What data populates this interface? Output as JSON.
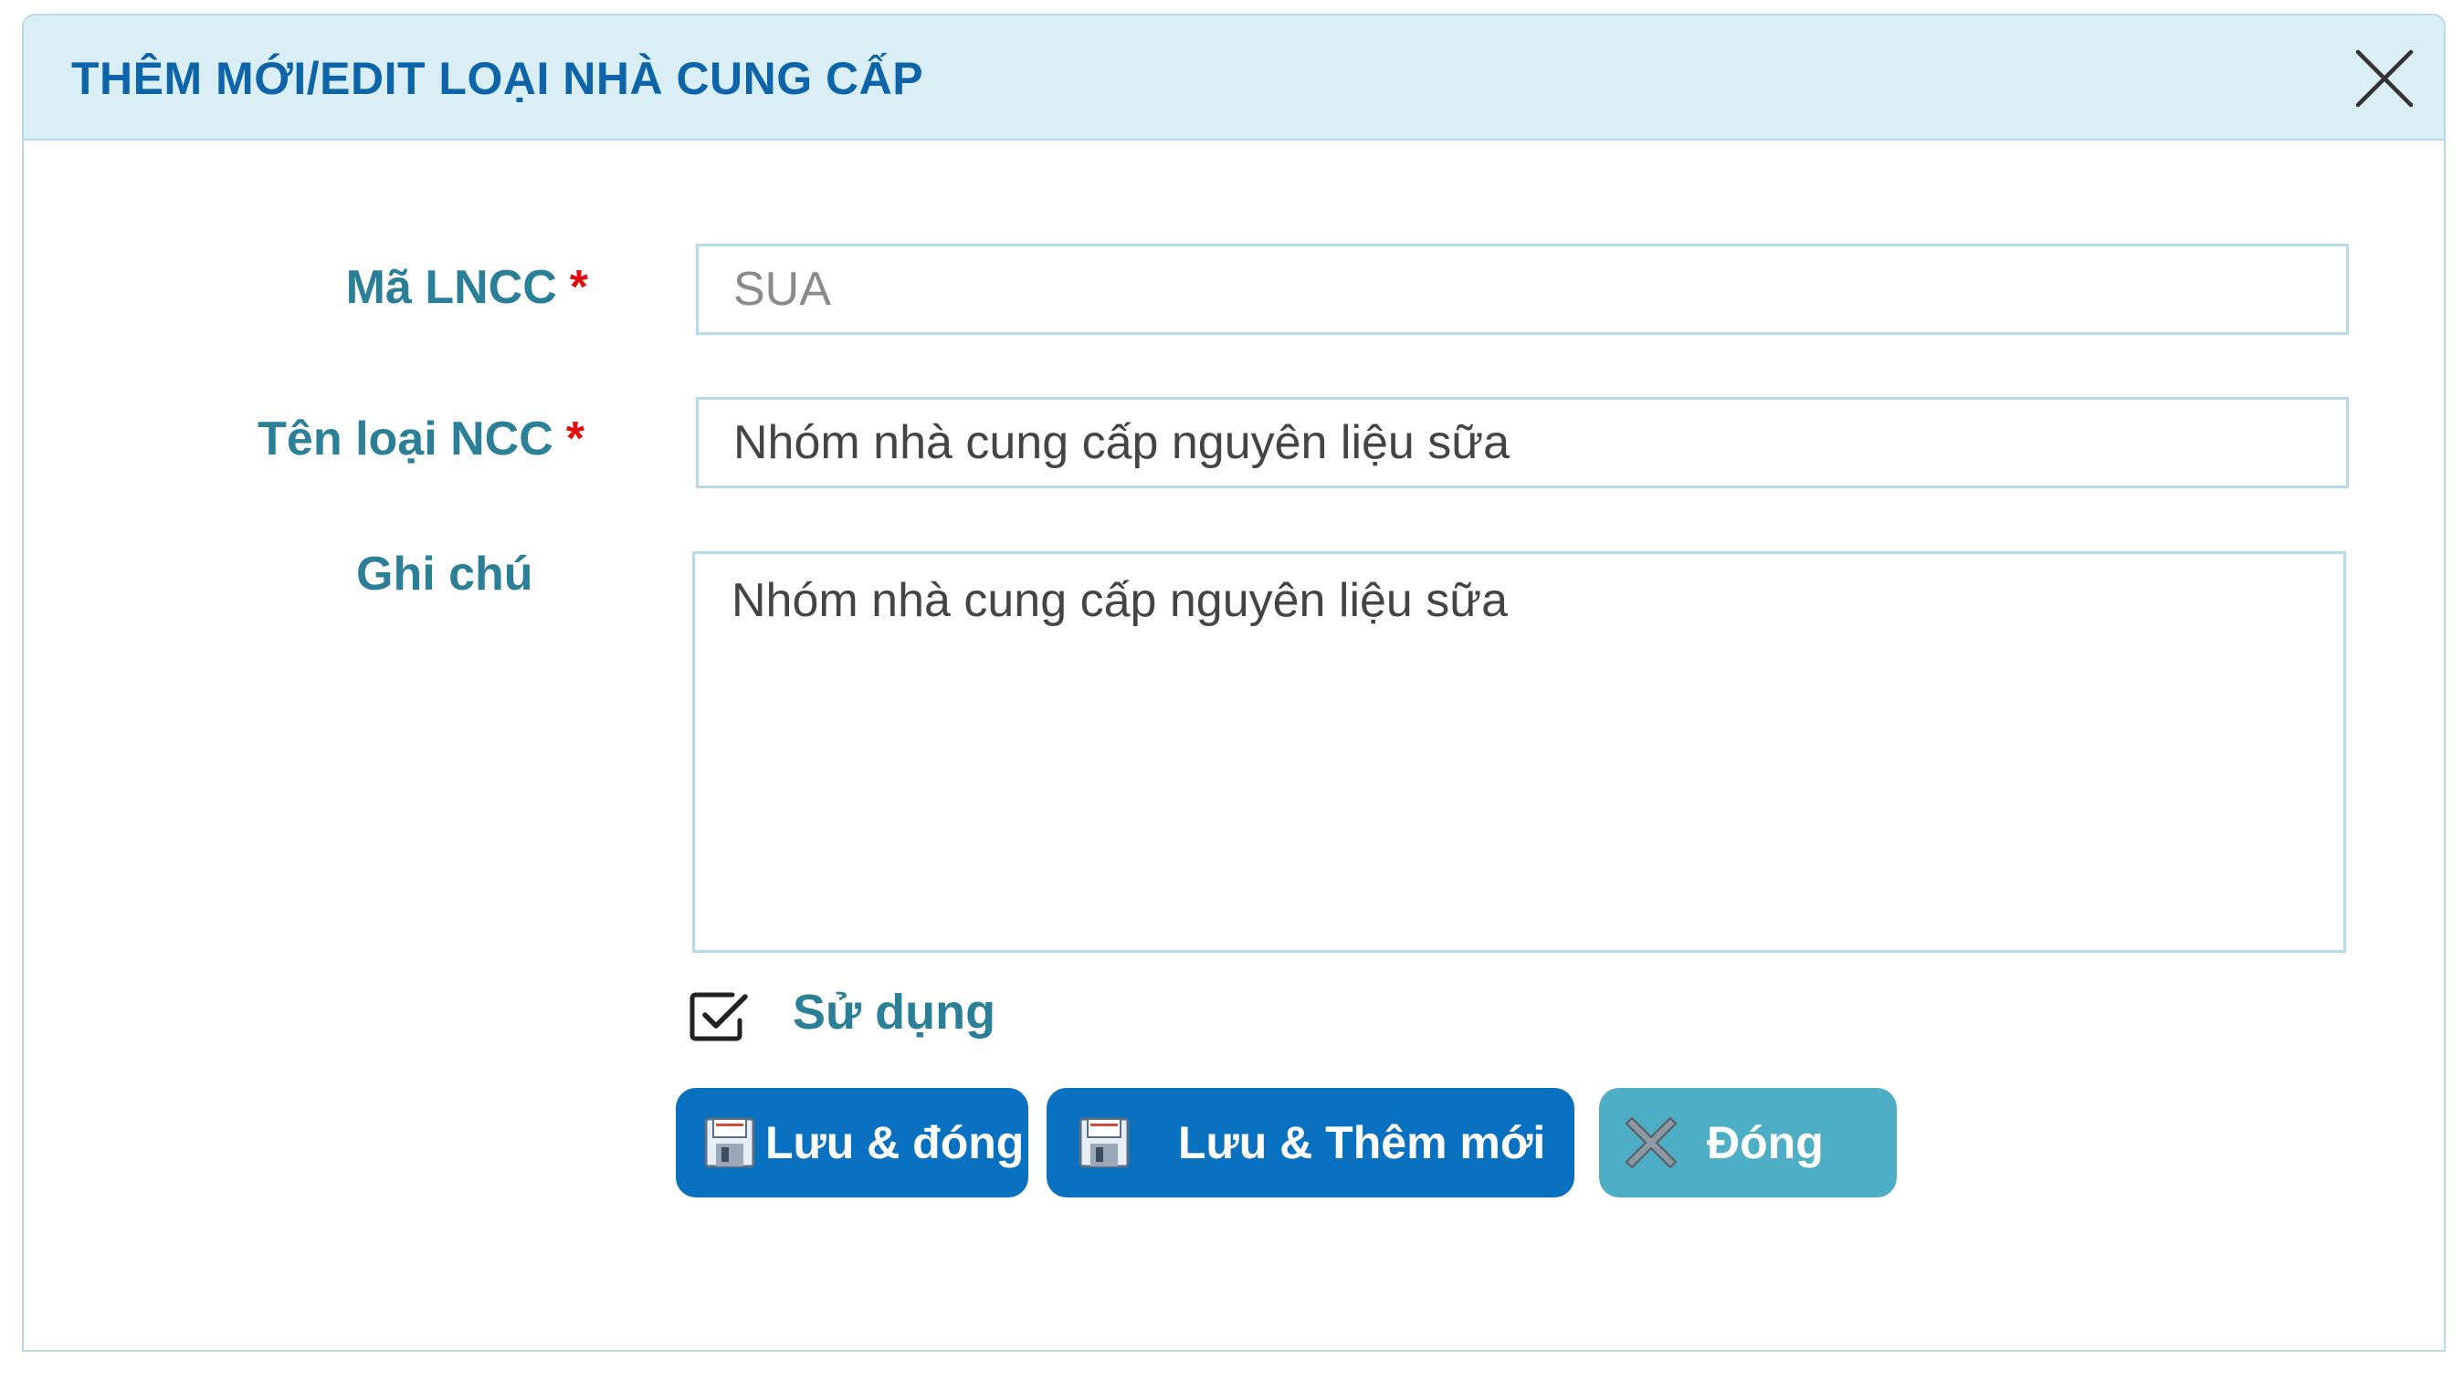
{
  "dialog": {
    "title": "THÊM MỚI/EDIT LOẠI NHÀ CUNG CẤP"
  },
  "form": {
    "code": {
      "label": "Mã LNCC",
      "required_mark": "*",
      "value": "SUA"
    },
    "name": {
      "label": "Tên loại NCC",
      "required_mark": "*",
      "value": "Nhóm nhà cung cấp nguyên liệu sữa"
    },
    "note": {
      "label": "Ghi chú",
      "value": "Nhóm nhà cung cấp nguyên liệu sữa"
    },
    "in_use": {
      "label": "Sử dụng",
      "checked": true
    }
  },
  "buttons": {
    "save_close": "Lưu & đóng",
    "save_new": "Lưu & Thêm mới",
    "close": "Đóng"
  },
  "colors": {
    "header_bg": "#daeef5",
    "title": "#0e64a8",
    "label": "#2b7f97",
    "required": "#e01010",
    "primary_button": "#0a70c0",
    "secondary_button": "#4eaec6"
  },
  "icons": {
    "close": "close-icon",
    "check": "checkbox-checked-icon",
    "save": "floppy-disk-icon",
    "cancel": "x-icon"
  }
}
